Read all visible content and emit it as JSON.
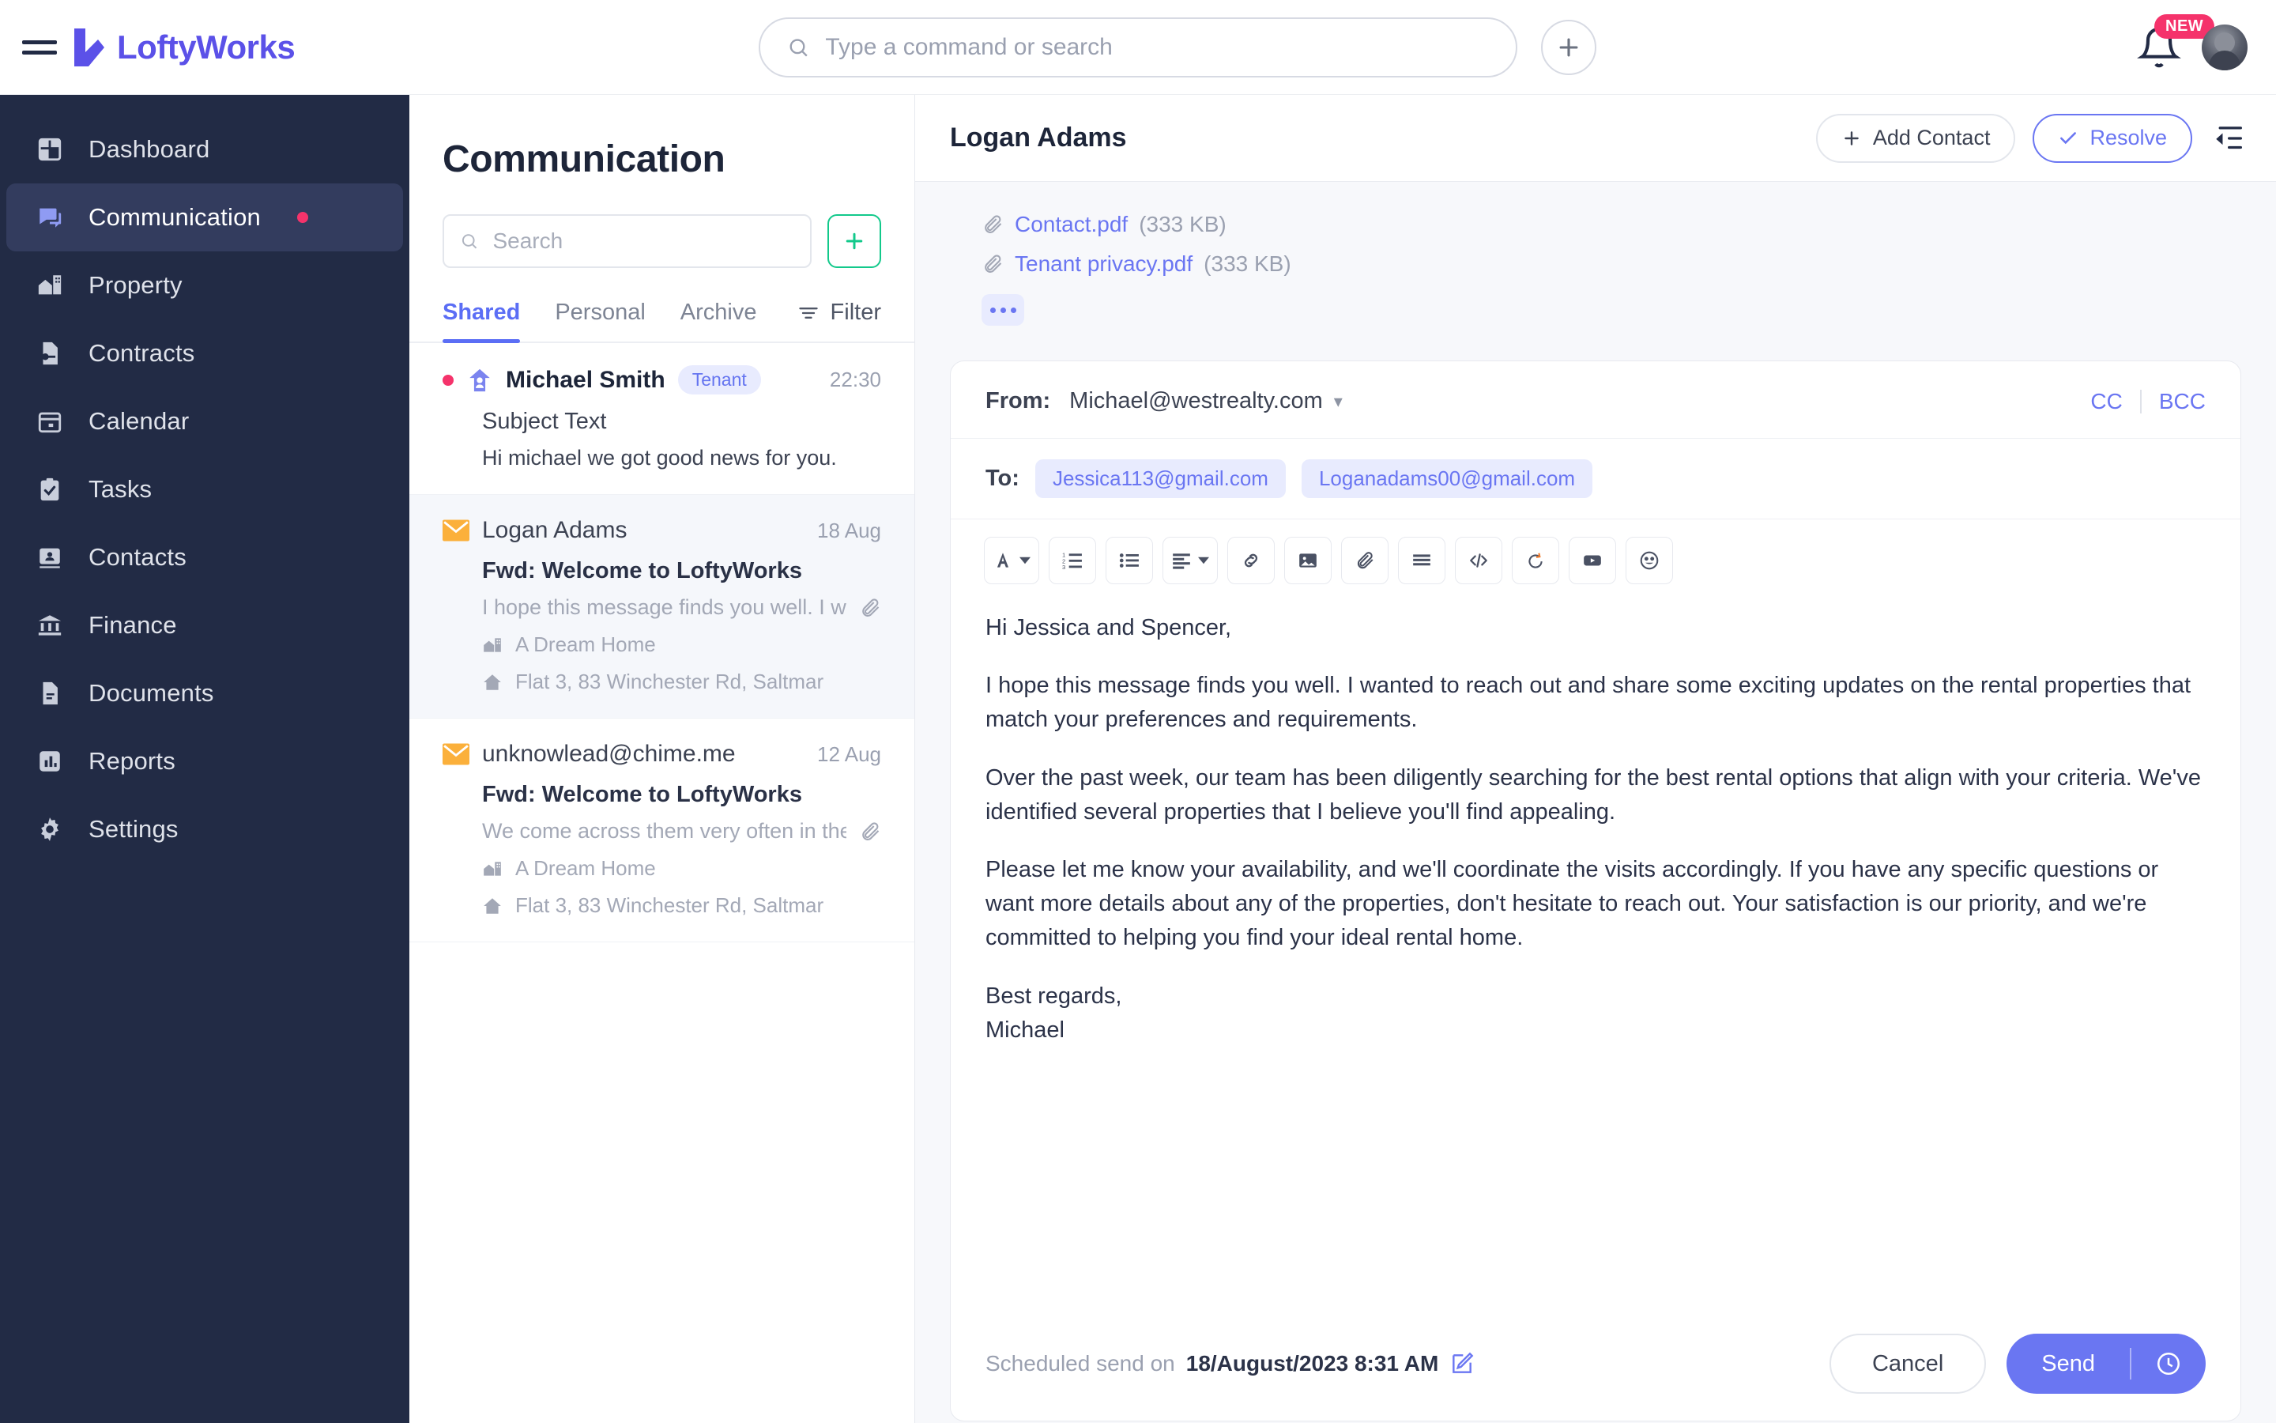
{
  "brand": {
    "name": "LoftyWorks"
  },
  "topbar": {
    "menu_icon": "hamburger-menu-icon",
    "search_placeholder": "Type a command or search",
    "search_value": "",
    "add_icon": "plus-icon",
    "notification_badge": "NEW",
    "bell_icon": "bell-icon",
    "avatar_icon": "user-avatar"
  },
  "sidebar": {
    "items": [
      {
        "label": "Dashboard",
        "icon": "dashboard-icon",
        "active": false,
        "dot": false
      },
      {
        "label": "Communication",
        "icon": "chat-bubble-icon",
        "active": true,
        "dot": true
      },
      {
        "label": "Property",
        "icon": "building-icon",
        "active": false,
        "dot": false
      },
      {
        "label": "Contracts",
        "icon": "contract-key-icon",
        "active": false,
        "dot": false
      },
      {
        "label": "Calendar",
        "icon": "calendar-icon",
        "active": false,
        "dot": false
      },
      {
        "label": "Tasks",
        "icon": "clipboard-check-icon",
        "active": false,
        "dot": false
      },
      {
        "label": "Contacts",
        "icon": "contact-card-icon",
        "active": false,
        "dot": false
      },
      {
        "label": "Finance",
        "icon": "bank-icon",
        "active": false,
        "dot": false
      },
      {
        "label": "Documents",
        "icon": "document-icon",
        "active": false,
        "dot": false
      },
      {
        "label": "Reports",
        "icon": "bar-chart-icon",
        "active": false,
        "dot": false
      },
      {
        "label": "Settings",
        "icon": "gear-icon",
        "active": false,
        "dot": false
      }
    ]
  },
  "list_panel": {
    "title": "Communication",
    "search_placeholder": "Search",
    "search_value": "",
    "add_button_icon": "plus-icon",
    "tabs": [
      {
        "label": "Shared",
        "active": true
      },
      {
        "label": "Personal",
        "active": false
      },
      {
        "label": "Archive",
        "active": false
      }
    ],
    "filter_label": "Filter",
    "messages": [
      {
        "from": "Michael Smith",
        "tag": "Tenant",
        "time": "22:30",
        "subject": "Subject Text",
        "preview": "Hi michael we got good news for you.",
        "unread": true,
        "selected": false,
        "has_attachment": false,
        "property": "",
        "address": ""
      },
      {
        "from": "Logan Adams",
        "tag": "",
        "time": "18 Aug",
        "subject": "Fwd: Welcome to LoftyWorks",
        "preview": "I hope this message finds you well. I w...",
        "unread": false,
        "selected": true,
        "has_attachment": true,
        "property": "A Dream Home",
        "address": "Flat 3, 83 Winchester Rd, Saltmar"
      },
      {
        "from": "unknowlead@chime.me",
        "tag": "",
        "time": "12 Aug",
        "subject": "Fwd: Welcome to LoftyWorks",
        "preview": "We come across them very often in the...",
        "unread": false,
        "selected": false,
        "has_attachment": true,
        "property": "A Dream Home",
        "address": "Flat 3, 83 Winchester Rd, Saltmar"
      }
    ]
  },
  "main": {
    "title": "Logan Adams",
    "add_contact_label": "Add Contact",
    "resolve_label": "Resolve",
    "collapse_icon": "collapse-panel-icon",
    "attachments": [
      {
        "name": "Contact.pdf",
        "size": "(333 KB)"
      },
      {
        "name": "Tenant privacy.pdf",
        "size": "(333 KB)"
      }
    ],
    "more_button_icon": "ellipsis-icon"
  },
  "composer": {
    "from_label": "From:",
    "from_value": "Michael@westrealty.com",
    "cc_label": "CC",
    "bcc_label": "BCC",
    "to_label": "To:",
    "recipients": [
      "Jessica113@gmail.com",
      "Loganadams00@gmail.com"
    ],
    "toolbar": [
      {
        "icon": "font-format-icon",
        "name": "text-format-button"
      },
      {
        "icon": "numbered-list-icon",
        "name": "numbered-list-button"
      },
      {
        "icon": "bullet-list-icon",
        "name": "bullet-list-button"
      },
      {
        "icon": "align-left-icon",
        "name": "align-button"
      },
      {
        "icon": "link-icon",
        "name": "insert-link-button"
      },
      {
        "icon": "image-icon",
        "name": "insert-image-button"
      },
      {
        "icon": "paperclip-icon",
        "name": "attach-file-button"
      },
      {
        "icon": "lines-icon",
        "name": "insert-divider-button"
      },
      {
        "icon": "code-icon",
        "name": "code-view-button"
      },
      {
        "icon": "undo-icon",
        "name": "undo-button"
      },
      {
        "icon": "video-icon",
        "name": "insert-video-button"
      },
      {
        "icon": "emoji-icon",
        "name": "emoji-button"
      }
    ],
    "body_paragraphs": [
      "Hi Jessica and Spencer,",
      "I hope this message finds you well. I wanted to reach out and share some exciting updates on the rental properties that match your preferences and requirements.",
      "Over the past week, our team has been diligently searching for the best rental options that align with your criteria. We've identified several properties that I believe you'll find appealing.",
      "Please let me know your availability, and we'll coordinate the visits accordingly. If you have any specific questions or want more details about any of the properties, don't hesitate to reach out. Your satisfaction is our priority, and we're committed to helping you find your ideal rental home.",
      "Best regards,",
      "Michael"
    ],
    "scheduled_label": "Scheduled send on",
    "scheduled_date": "18/August/2023 8:31 AM",
    "edit_icon": "edit-pencil-icon",
    "cancel_label": "Cancel",
    "send_label": "Send",
    "send_clock_icon": "clock-icon"
  },
  "colors": {
    "brand": "#5b51e8",
    "accent": "#6a76f2",
    "sidebar_bg": "#222b45",
    "sidebar_active": "#333c5e",
    "badge_pink": "#f5336b",
    "green": "#12c98b",
    "envelope_orange": "#fbb03b"
  }
}
